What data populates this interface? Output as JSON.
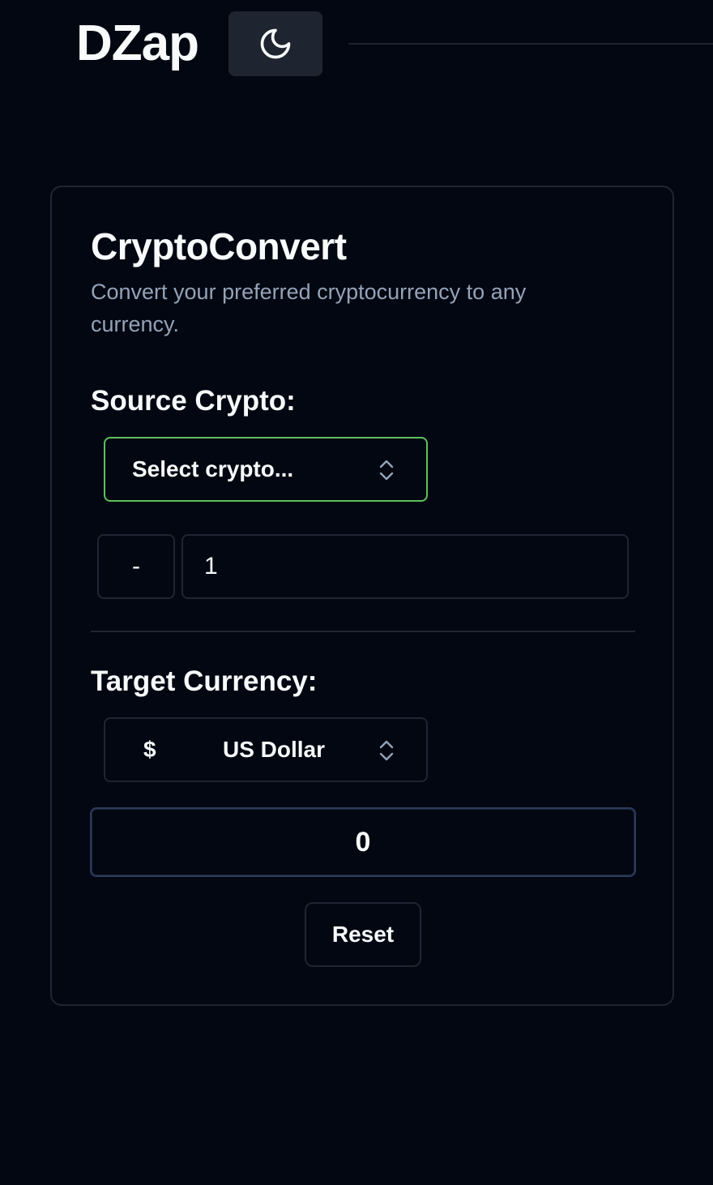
{
  "header": {
    "brand": "DZap",
    "theme_toggle_icon": "moon-icon"
  },
  "converter": {
    "title": "CryptoConvert",
    "description": "Convert your preferred cryptocurrency to any currency.",
    "source_label": "Source Crypto:",
    "source_select_placeholder": "Select crypto...",
    "decrement_label": "-",
    "amount_value": "1",
    "target_label": "Target Currency:",
    "target_currency_symbol": "$",
    "target_currency_name": "US Dollar",
    "result_value": "0",
    "reset_label": "Reset"
  },
  "colors": {
    "background": "#030711",
    "focus_border": "#5fbf5c",
    "border": "#1e2533",
    "muted_text": "#94a3b8"
  }
}
